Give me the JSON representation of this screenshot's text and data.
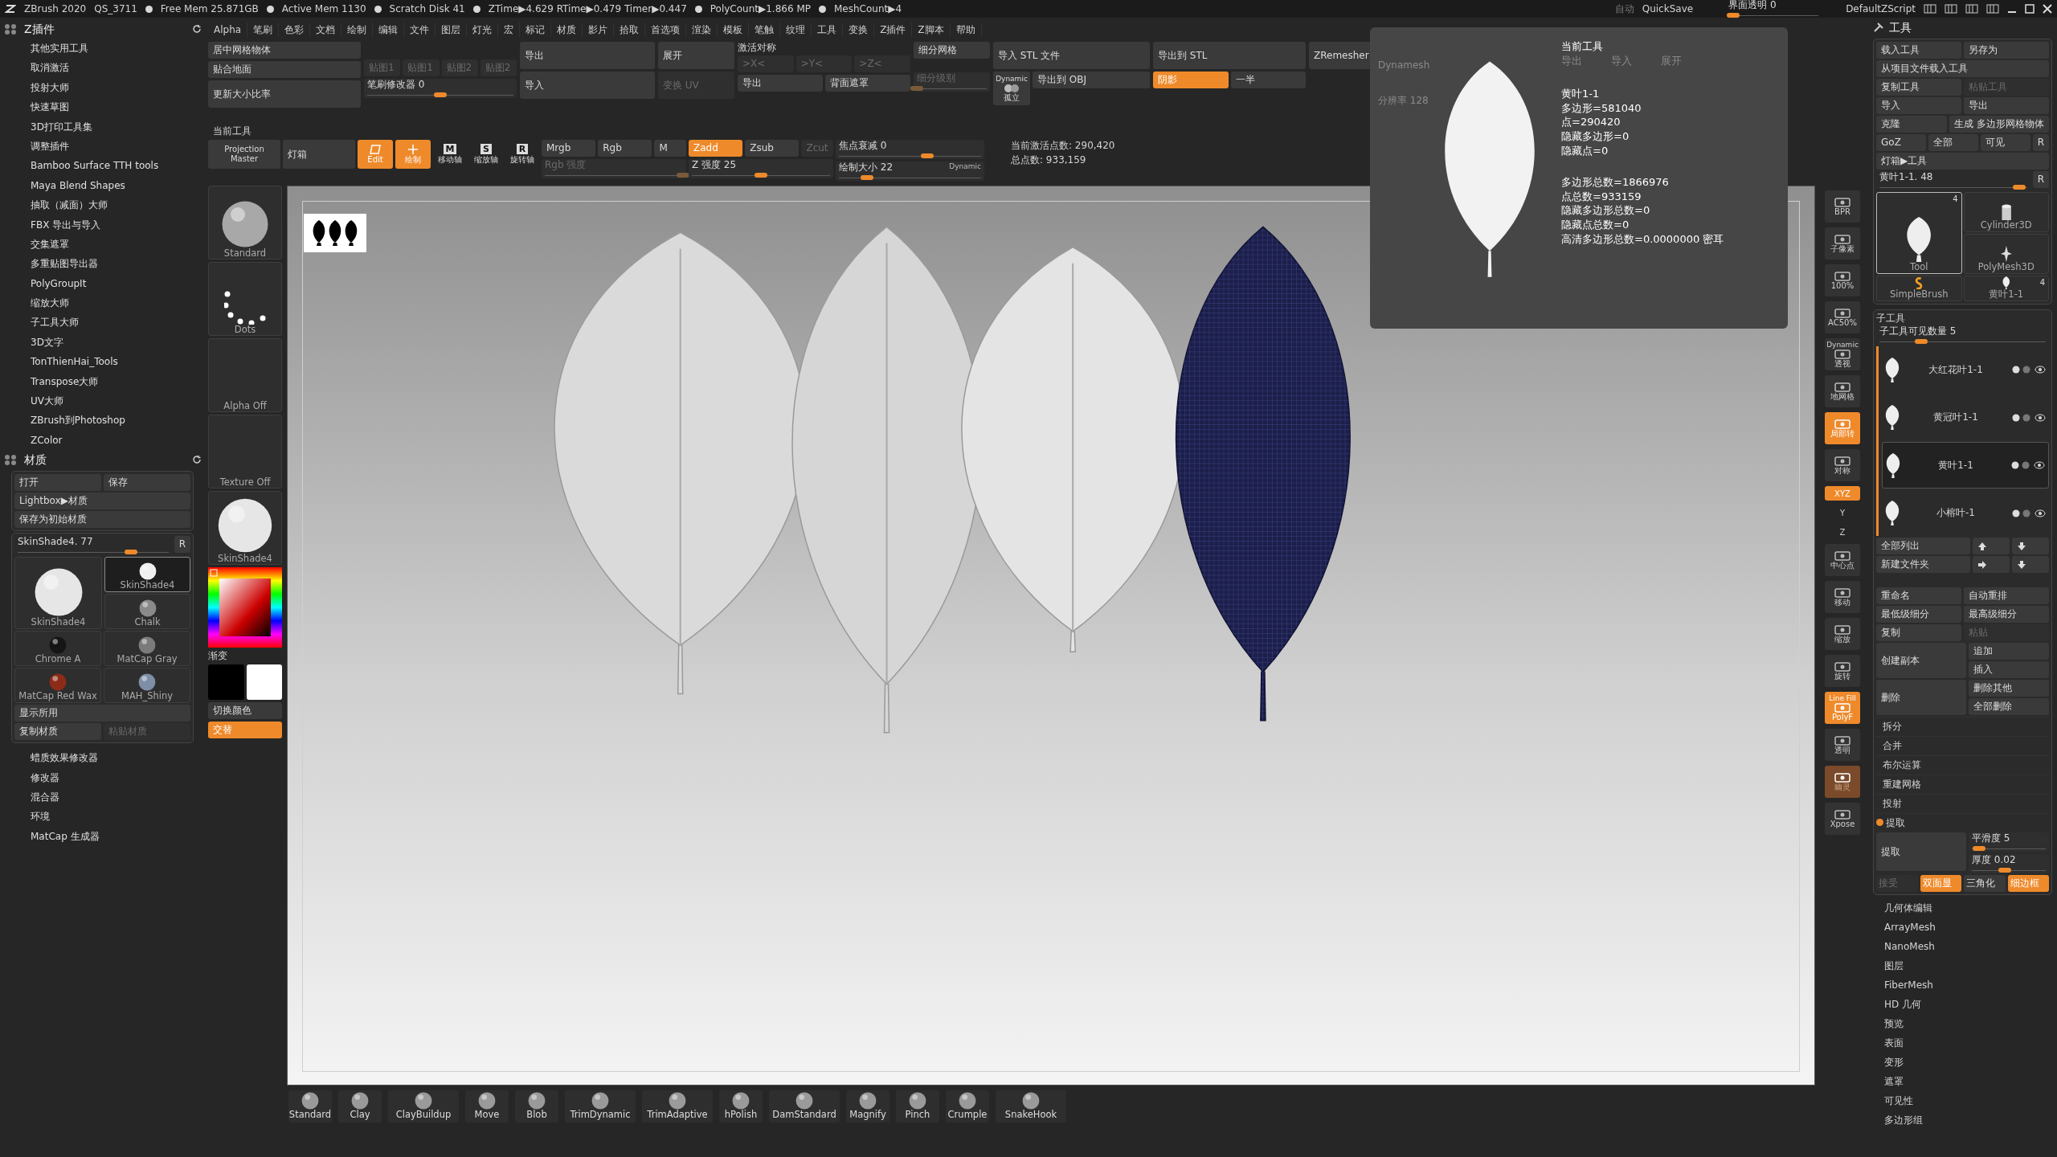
{
  "status_bar": {
    "app": "ZBrush 2020",
    "session": "QS_3711",
    "stats": [
      "Free Mem 25.871GB",
      "Active Mem 1130",
      "Scratch Disk 41",
      "ZTime▶4.629 RTime▶0.479 Timer▶0.447",
      "PolyCount▶1.866 MP",
      "MeshCount▶4"
    ],
    "auto": "自动",
    "quicksave": "QuickSave",
    "transparency": {
      "label": "界面透明 0",
      "level": 0.05
    },
    "script": "DefaultZScript"
  },
  "menu": [
    "Alpha",
    "笔刷",
    "色彩",
    "文档",
    "绘制",
    "编辑",
    "文件",
    "图层",
    "灯光",
    "宏",
    "标记",
    "材质",
    "影片",
    "拾取",
    "首选项",
    "渲染",
    "模板",
    "笔触",
    "纹理",
    "工具",
    "变换",
    "Z插件",
    "Z脚本",
    "帮助"
  ],
  "shelf": {
    "columns": [
      [
        {
          "kind": "button",
          "text": "居中网格物体",
          "on": false,
          "disabled": false
        },
        {
          "kind": "button",
          "text": "贴合地面",
          "on": false,
          "disabled": false
        },
        {
          "kind": "button",
          "text": "更新大小比率",
          "on": false,
          "disabled": false
        }
      ],
      [
        {
          "kind": "row",
          "items": [
            {
              "kind": "button",
              "text": "贴图1",
              "on": false,
              "disabled": true
            },
            {
              "kind": "button",
              "text": "贴图1",
              "on": false,
              "disabled": true
            },
            {
              "kind": "button",
              "text": "贴图2",
              "on": false,
              "disabled": true
            },
            {
              "kind": "button",
              "text": "贴图2",
              "on": false,
              "disabled": true
            }
          ]
        },
        {
          "kind": "slider",
          "text": "笔刷修改器 0",
          "level": 0.5,
          "disabled": false
        }
      ],
      [
        {
          "kind": "button",
          "text": "导出",
          "on": false,
          "disabled": false
        },
        {
          "kind": "button",
          "text": "导入",
          "on": false,
          "disabled": false
        }
      ],
      [
        {
          "kind": "button",
          "text": "展开",
          "on": false,
          "disabled": false
        },
        {
          "kind": "button",
          "text": "变换 UV",
          "on": false,
          "disabled": true
        }
      ],
      [
        {
          "kind": "label",
          "text": "激活对称"
        },
        {
          "kind": "row",
          "items": [
            {
              "kind": "button",
              "text": ">X<",
              "on": false,
              "disabled": true
            },
            {
              "kind": "button",
              "text": ">Y<",
              "on": false,
              "disabled": true
            },
            {
              "kind": "button",
              "text": ">Z<",
              "on": false,
              "disabled": true
            }
          ]
        },
        {
          "kind": "row",
          "items": [
            {
              "kind": "button",
              "text": "导出",
              "on": false,
              "disabled": false
            },
            {
              "kind": "button",
              "text": "背面遮罩",
              "on": false,
              "disabled": false
            }
          ]
        }
      ],
      [
        {
          "kind": "button",
          "text": "细分网格",
          "on": false,
          "disabled": false
        },
        {
          "kind": "slider",
          "text": "细分级别",
          "level": 0.0,
          "disabled": true
        }
      ],
      [
        {
          "kind": "button",
          "text": "导入 STL 文件",
          "on": false,
          "disabled": false
        },
        {
          "kind": "row",
          "items": [
            {
              "kind": "isolate",
              "caption": "Dynamic",
              "text": "孤立",
              "on": false,
              "disabled": false
            },
            {
              "kind": "button",
              "text": "导出到 OBJ",
              "on": false,
              "disabled": false
            }
          ]
        }
      ],
      [
        {
          "kind": "button",
          "text": "导出到 STL",
          "on": false,
          "disabled": false
        },
        {
          "kind": "row",
          "items": [
            {
              "kind": "button",
              "text": "阴影",
              "on": true,
              "disabled": false
            },
            {
              "kind": "button",
              "text": "一半",
              "on": false,
              "disabled": false
            }
          ]
        }
      ],
      [
        {
          "kind": "button",
          "text": "ZRemesher",
          "on": false,
          "disabled": false
        }
      ]
    ]
  },
  "tool_row": {
    "title": "当前工具",
    "items": [
      {
        "kind": "button",
        "text": "Projection Master",
        "on": false,
        "disabled": false
      },
      {
        "kind": "button",
        "text": "灯箱",
        "on": false,
        "disabled": false
      },
      {
        "kind": "mode",
        "text": "Edit",
        "on": true,
        "disabled": false
      },
      {
        "kind": "mode",
        "text": "绘制",
        "on": true,
        "disabled": false
      },
      {
        "kind": "axis",
        "key": "M",
        "text": "移动轴",
        "on": false,
        "disabled": false
      },
      {
        "kind": "axis",
        "key": "S",
        "text": "缩放轴",
        "on": false,
        "disabled": false
      },
      {
        "kind": "axis",
        "key": "R",
        "text": "旋转轴",
        "on": false,
        "disabled": false
      },
      {
        "kind": "stack",
        "top": [
          {
            "text": "Mrgb",
            "on": false,
            "disabled": false
          },
          {
            "text": "Rgb",
            "on": false,
            "disabled": false
          },
          {
            "text": "M",
            "on": false,
            "disabled": false
          }
        ],
        "slider": {
          "text": "Rgb 强度",
          "level": 1.0,
          "disabled": true
        }
      },
      {
        "kind": "stack",
        "top": [
          {
            "text": "Zadd",
            "on": true,
            "disabled": false
          },
          {
            "text": "Zsub",
            "on": false,
            "disabled": false
          },
          {
            "text": "Zcut",
            "on": false,
            "disabled": true
          }
        ],
        "slider": {
          "text": "Z 强度 25",
          "level": 0.5,
          "disabled": false
        }
      },
      {
        "kind": "sliders",
        "sliders": [
          {
            "text": "焦点衰减 0",
            "level": 0.62,
            "disabled": false
          },
          {
            "text": "绘制大小 22",
            "level": 0.2,
            "disabled": false,
            "caption": "Dynamic"
          }
        ]
      },
      {
        "kind": "info",
        "lines": [
          "当前激活点数: 290,420",
          "总点数: 933,159"
        ]
      }
    ]
  },
  "left_panel": {
    "zplugin": {
      "title": "Z插件",
      "items": [
        "其他实用工具",
        "取消激活",
        "投射大师",
        "快速草图",
        "3D打印工具集",
        "调整插件",
        "Bamboo Surface TTH tools",
        "Maya Blend Shapes",
        "抽取（减面）大师",
        "FBX 导出与导入",
        "交集遮罩",
        "多重贴图导出器",
        "PolyGroupIt",
        "缩放大师",
        "子工具大师",
        "3D文字",
        "TonThienHai_Tools",
        "Transpose大师",
        "UV大师",
        "ZBrush到Photoshop",
        "ZColor"
      ]
    },
    "material": {
      "title": "材质",
      "button_rows": [
        [
          {
            "text": "打开",
            "on": false,
            "disabled": false
          },
          {
            "text": "保存",
            "on": false,
            "disabled": false
          }
        ],
        [
          {
            "text": "Lightbox▶材质",
            "on": false,
            "disabled": false
          }
        ],
        [
          {
            "text": "保存为初始材质",
            "on": false,
            "disabled": false
          }
        ]
      ],
      "current": {
        "label": "SkinShade4. 77",
        "level": 0.75
      },
      "reset": "R",
      "preview": {
        "name": "SkinShade4",
        "color": "#e6e6e6"
      },
      "thumbs": [
        {
          "name": "SkinShade4",
          "color": "#efefef",
          "selected": true
        },
        {
          "name": "Chalk",
          "color": "#8a8a8a",
          "selected": false
        },
        {
          "name": "Chrome A",
          "color": "#151515",
          "selected": false
        },
        {
          "name": "MatCap Gray",
          "color": "#7b7b7b",
          "selected": false
        },
        {
          "name": "MatCap Red Wax",
          "color": "#8c2c18",
          "selected": false
        },
        {
          "name": "MAH_Shiny",
          "color": "#7d8ea6",
          "selected": false
        }
      ],
      "show_used": {
        "text": "显示所用",
        "on": false,
        "disabled": false
      },
      "copy": {
        "text": "复制材质",
        "on": false,
        "disabled": false
      },
      "paste": {
        "text": "粘贴材质",
        "on": false,
        "disabled": true
      }
    },
    "more": [
      "蜡质效果修改器",
      "修改器",
      "混合器",
      "环境",
      "MatCap 生成器"
    ]
  },
  "left_shelf": {
    "thumbs": [
      {
        "text": "Standard",
        "kind": "brush"
      },
      {
        "text": "Dots",
        "kind": "dots"
      },
      {
        "text": "Alpha Off",
        "kind": "empty"
      },
      {
        "text": "Texture Off",
        "kind": "empty"
      },
      {
        "text": "SkinShade4",
        "kind": "sphere"
      }
    ],
    "gradient": "渐变",
    "swatches": [
      {
        "color": "#000000"
      },
      {
        "color": "#ffffff"
      }
    ],
    "switch": {
      "text": "切换颜色",
      "on": false,
      "disabled": false
    },
    "alternate": {
      "text": "交替",
      "on": true,
      "disabled": false
    }
  },
  "overlay": {
    "title": "当前工具",
    "faded": [
      "Dynamesh",
      "分辨率 128",
      "导出",
      "导入",
      "展开"
    ],
    "tool": "黄叶1-1",
    "stats": [
      "多边形=581040",
      "点=290420",
      "隐藏多边形=0",
      "隐藏点=0"
    ],
    "totals": [
      "多边形总数=1866976",
      "点总数=933159",
      "隐藏多边形总数=0",
      "隐藏点总数=0",
      "高清多边形总数=0.0000000 密耳"
    ]
  },
  "side_toolbar": [
    {
      "kind": "button",
      "label": "BPR",
      "on": false,
      "disabled": false
    },
    {
      "kind": "button",
      "label": "子像素",
      "on": false,
      "disabled": false
    },
    {
      "kind": "button",
      "label": "100%",
      "on": false,
      "disabled": false
    },
    {
      "kind": "button",
      "label": "AC50%",
      "on": false,
      "disabled": false
    },
    {
      "kind": "button",
      "caption": "Dynamic",
      "label": "透视",
      "on": false,
      "disabled": false
    },
    {
      "kind": "button",
      "label": "地网格",
      "on": false,
      "disabled": false
    },
    {
      "kind": "button",
      "label": "局部转",
      "on": true,
      "disabled": false
    },
    {
      "kind": "button",
      "label": "对称",
      "on": false,
      "disabled": false
    },
    {
      "kind": "small",
      "label": "XYZ",
      "on": true,
      "disabled": false
    },
    {
      "kind": "small",
      "label": "Y",
      "on": false,
      "disabled": false
    },
    {
      "kind": "small",
      "label": "Z",
      "on": false,
      "disabled": false
    },
    {
      "kind": "button",
      "label": "中心点",
      "on": false,
      "disabled": false
    },
    {
      "kind": "button",
      "label": "移动",
      "on": false,
      "disabled": false
    },
    {
      "kind": "button",
      "label": "缩放",
      "on": false,
      "disabled": false
    },
    {
      "kind": "button",
      "label": "旋转",
      "on": false,
      "disabled": false
    },
    {
      "kind": "button",
      "caption": "Line Fill",
      "label": "PolyF",
      "on": true,
      "disabled": false
    },
    {
      "kind": "button",
      "label": "透明",
      "on": false,
      "disabled": false
    },
    {
      "kind": "button",
      "label": "幽灵",
      "on": true,
      "disabled": true
    },
    {
      "kind": "button",
      "label": "Xpose",
      "on": false,
      "disabled": false
    }
  ],
  "brushes": [
    "Standard",
    "Clay",
    "ClayBuildup",
    "Move",
    "Blob",
    "TrimDynamic",
    "TrimAdaptive",
    "hPolish",
    "DamStandard",
    "Magnify",
    "Pinch",
    "Crumple",
    "SnakeHook"
  ],
  "tool_panel": {
    "title": "工具",
    "rows": [
      [
        {
          "text": "载入工具",
          "on": false,
          "disabled": false
        },
        {
          "text": "另存为",
          "on": false,
          "disabled": false
        }
      ],
      [
        {
          "text": "从项目文件载入工具",
          "on": false,
          "disabled": false
        }
      ],
      [
        {
          "text": "复制工具",
          "on": false,
          "disabled": false
        },
        {
          "text": "粘贴工具",
          "on": false,
          "disabled": true
        }
      ],
      [
        {
          "text": "导入",
          "on": false,
          "disabled": false
        },
        {
          "text": "导出",
          "on": false,
          "disabled": false
        }
      ],
      [
        {
          "text": "克隆",
          "on": false,
          "disabled": false
        },
        {
          "text": "生成 多边形网格物体",
          "on": false,
          "disabled": false
        }
      ],
      [
        {
          "text": "GoZ",
          "on": false,
          "disabled": false
        },
        {
          "text": "全部",
          "on": false,
          "disabled": false
        },
        {
          "text": "可见",
          "on": false,
          "disabled": false
        },
        {
          "text": "R",
          "on": false,
          "disabled": false
        }
      ],
      [
        {
          "text": "灯箱▶工具",
          "on": false,
          "disabled": false
        }
      ]
    ],
    "current": {
      "label": "黄叶1-1. 48",
      "level": 0.95
    },
    "reset": "R",
    "thumbs": [
      {
        "name": "Tool",
        "kind": "leaf",
        "badge": "4",
        "selected": true
      },
      {
        "name": "Cylinder3D",
        "kind": "cylinder",
        "selected": false
      },
      {
        "name": "PolyMesh3D",
        "kind": "star",
        "selected": false
      },
      {
        "name": "SimpleBrush",
        "kind": "brush",
        "selected": false
      },
      {
        "name": "黄叶1-1",
        "kind": "leaf",
        "badge": "4",
        "selected": false
      }
    ],
    "subtool": {
      "title": "子工具",
      "visible": {
        "label": "子工具可见数量 5",
        "level": 0.25
      },
      "items": [
        {
          "name": "大红花叶1-1",
          "selected": false
        },
        {
          "name": "黄冠叶1-1",
          "selected": false
        },
        {
          "name": "黄叶1-1",
          "selected": true
        },
        {
          "name": "小榕叶-1",
          "selected": false
        }
      ],
      "list_all": {
        "text": "全部列出",
        "on": false,
        "disabled": false
      },
      "new_folder": {
        "text": "新建文件夹",
        "on": false,
        "disabled": false
      },
      "rows": [
        [
          {
            "text": "重命名",
            "on": false,
            "disabled": false
          },
          {
            "text": "自动重排",
            "on": false,
            "disabled": false
          }
        ],
        [
          {
            "text": "最低级细分",
            "on": false,
            "disabled": false
          },
          {
            "text": "最高级细分",
            "on": false,
            "disabled": false
          }
        ],
        [
          {
            "text": "复制",
            "on": false,
            "disabled": false
          },
          {
            "text": "粘贴",
            "on": false,
            "disabled": true
          }
        ]
      ],
      "groups": [
        {
          "main": {
            "text": "创建副本",
            "on": false,
            "disabled": false
          },
          "subs": [
            {
              "text": "追加",
              "on": false,
              "disabled": false
            },
            {
              "text": "插入",
              "on": false,
              "disabled": false
            }
          ]
        },
        {
          "main": {
            "text": "删除",
            "on": false,
            "disabled": false
          },
          "subs": [
            {
              "text": "删除其他",
              "on": false,
              "disabled": false
            },
            {
              "text": "全部删除",
              "on": false,
              "disabled": false
            }
          ]
        }
      ],
      "sections": [
        {
          "text": "拆分",
          "expanded": false
        },
        {
          "text": "合并",
          "expanded": false
        },
        {
          "text": "布尔运算",
          "expanded": false
        },
        {
          "text": "重建网格",
          "expanded": false
        },
        {
          "text": "投射",
          "expanded": false
        },
        {
          "text": "提取",
          "expanded": true
        }
      ],
      "extract": {
        "button": {
          "text": "提取",
          "on": false,
          "disabled": false
        },
        "smooth": {
          "label": "平滑度 5",
          "level": 0.1
        },
        "thickness": {
          "label": "厚度 0.02",
          "level": 0.45
        },
        "buttons": [
          {
            "text": "接受",
            "on": false,
            "disabled": true
          },
          {
            "text": "双面显",
            "on": true,
            "disabled": false
          },
          {
            "text": "三角化",
            "on": false,
            "disabled": false
          },
          {
            "text": "细边框",
            "on": true,
            "disabled": false
          }
        ]
      }
    },
    "sections": [
      "几何体编辑",
      "ArrayMesh",
      "NanoMesh",
      "图层",
      "FiberMesh",
      "HD 几何",
      "预览",
      "表面",
      "变形",
      "遮罩",
      "可见性",
      "多边形组"
    ]
  }
}
